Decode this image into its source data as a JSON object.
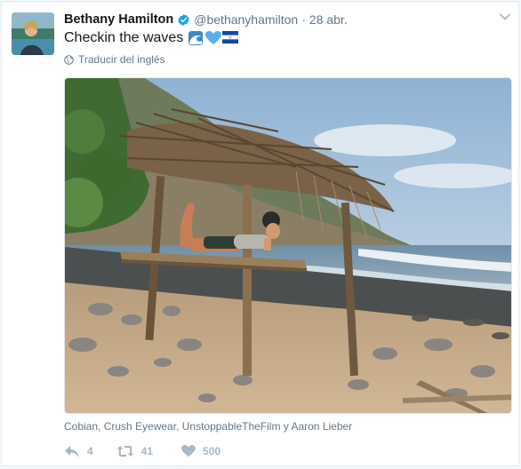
{
  "tweet": {
    "name": "Bethany Hamilton",
    "handle": "@bethanyhamilton",
    "separator": "·",
    "time": "28 abr.",
    "text": "Checkin the waves",
    "translate_label": "Traducir del inglés",
    "tagged": "Cobian, Crush Eyewear, UnstoppableTheFilm y Aaron Lieber",
    "actions": {
      "reply_count": "4",
      "retweet_count": "41",
      "like_count": "500"
    }
  },
  "icons": {
    "verified": "verified-badge-icon",
    "caret": "chevron-down-icon",
    "globe": "globe-icon",
    "reply": "reply-icon",
    "retweet": "retweet-icon",
    "like": "heart-icon",
    "emojis": [
      "wave-emoji",
      "blue-heart-emoji",
      "el-salvador-flag-emoji"
    ]
  },
  "colors": {
    "verified_blue": "#1da1f2",
    "muted_text": "#657786",
    "action_gray": "#aab8c2"
  }
}
